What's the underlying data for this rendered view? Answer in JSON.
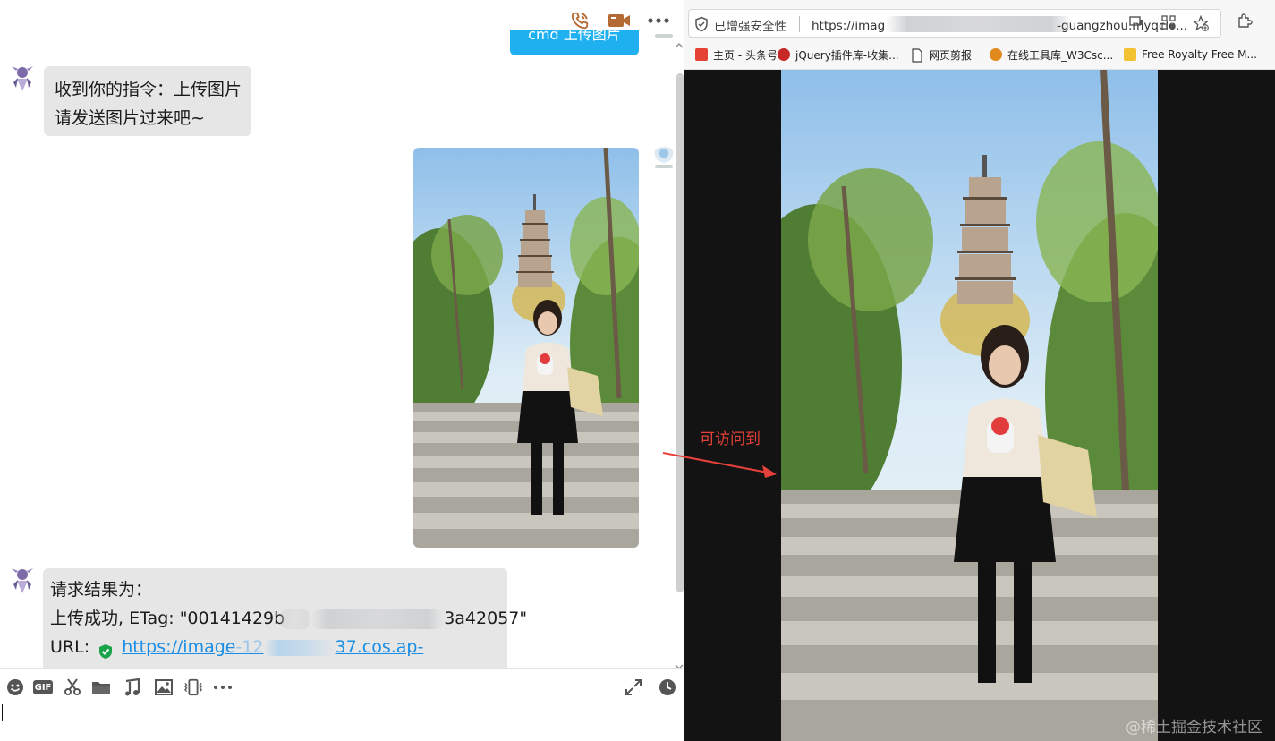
{
  "chat": {
    "top_icons": [
      "phone-icon",
      "video-call-icon",
      "more-icon"
    ],
    "outgoing_cmd": "cmd 上传图片",
    "incoming_1": {
      "line1": "收到你的指令：上传图片",
      "line2": "请发送图片过来吧~"
    },
    "result": {
      "line1": "请求结果为：",
      "line2_prefix": "上传成功, ETag: \"00141429b",
      "line2_mid": "d0",
      "line2_suffix": "3a42057\"",
      "line3_label": "URL: ",
      "url_visible_start": "https://image",
      "url_visible_mid": "-12",
      "url_visible_end": "37.cos.ap-"
    },
    "toolbar": [
      "emoji-icon",
      "gif-icon",
      "scissors-icon",
      "folder-icon",
      "music-icon",
      "image-icon",
      "vibrate-icon",
      "more-icon",
      "expand-icon",
      "history-icon"
    ],
    "gif_label": "GIF"
  },
  "browser": {
    "security_text": "已增强安全性",
    "url": "https://imag",
    "url_tail": "-guangzhou.myqclo...",
    "bookmarks": [
      {
        "label": "主页 - 头条号",
        "color": "#e34234"
      },
      {
        "label": "jQuery插件库-收集...",
        "color": "#c62828"
      },
      {
        "label": "网页剪报",
        "color": "#ffffff"
      },
      {
        "label": "在线工具库_W3Csc...",
        "color": "#e08a1e"
      },
      {
        "label": "Free Royalty Free M...",
        "color": "#f3c230"
      }
    ]
  },
  "annotation": {
    "text": "可访问到",
    "color": "#e5413a"
  },
  "watermark": "@稀土掘金技术社区"
}
